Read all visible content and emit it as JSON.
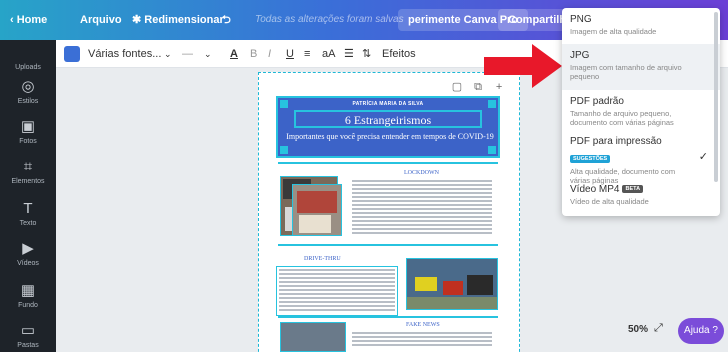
{
  "topbar": {
    "home": "Home",
    "file": "Arquivo",
    "resize": "Redimensionar",
    "undo_icon": "undo-icon",
    "status": "Todas as alterações foram salvas",
    "trial": "perimente Canva Pro",
    "share": "Compartilhar"
  },
  "sidebar": {
    "items": [
      {
        "label": "Uploads",
        "icon": "upload-icon"
      },
      {
        "label": "Estilos",
        "icon": "palette-icon"
      },
      {
        "label": "Fotos",
        "icon": "photo-icon"
      },
      {
        "label": "Elementos",
        "icon": "elements-icon"
      },
      {
        "label": "Texto",
        "icon": "text-icon"
      },
      {
        "label": "Vídeos",
        "icon": "video-icon"
      },
      {
        "label": "Fundo",
        "icon": "background-icon"
      },
      {
        "label": "Pastas",
        "icon": "folder-icon"
      }
    ]
  },
  "toolbar": {
    "font": "Várias fontes...",
    "size": "—",
    "effects": "Efeitos",
    "color": "#3b6fd6"
  },
  "document": {
    "author": "PATRÍCIA MARIA DA SILVA",
    "title": "6 Estrangeirismos",
    "subtitle": "Importantes que você precisa entender em tempos de COVID-19",
    "sec1": "LOCKDOWN",
    "sec2": "DRIVE-THRU",
    "sec3": "FAKE NEWS"
  },
  "download_menu": {
    "options": [
      {
        "title": "PNG",
        "desc": "Imagem de alta qualidade"
      },
      {
        "title": "JPG",
        "desc": "Imagem com tamanho de arquivo pequeno"
      },
      {
        "title": "PDF padrão",
        "desc": "Tamanho de arquivo pequeno, documento com várias páginas"
      },
      {
        "title": "PDF para impressão",
        "badge": "SUGESTÕES",
        "desc": "Alta qualidade, documento com várias páginas"
      },
      {
        "title": "Vídeo MP4",
        "badge": "BETA",
        "desc": "Vídeo de alta qualidade"
      }
    ]
  },
  "footer": {
    "zoom": "50%",
    "help": "Ajuda ?"
  },
  "colors": {
    "accent": "#27c3df",
    "brand": "#3c63c8",
    "arrow": "#e8182a",
    "help": "#7b4cd9"
  }
}
